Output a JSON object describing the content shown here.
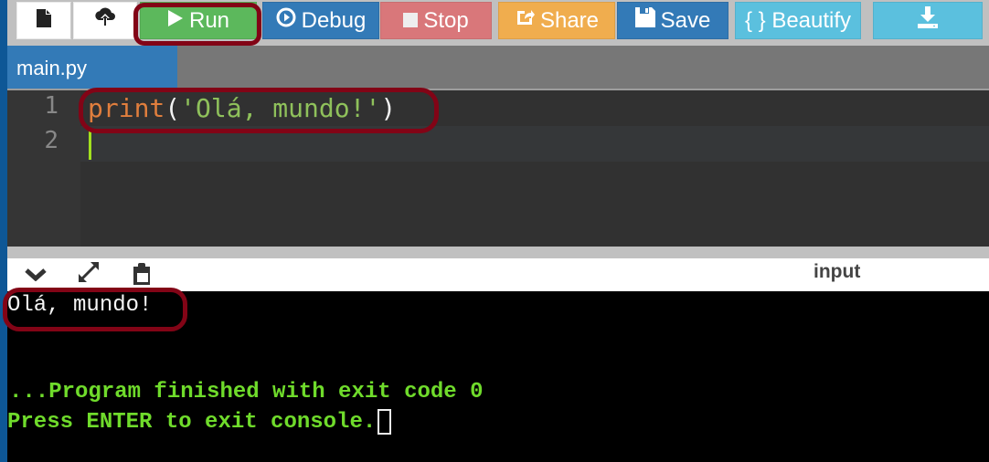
{
  "toolbar": {
    "new_file_icon": "file-icon",
    "upload_icon": "cloud-upload-icon",
    "run": {
      "label": "Run",
      "icon": "play-icon",
      "color": "#5cb85c"
    },
    "debug": {
      "label": "Debug",
      "icon": "circle-play-icon",
      "color": "#337ab7"
    },
    "stop": {
      "label": "Stop",
      "icon": "stop-square-icon",
      "color": "#d9777a"
    },
    "share": {
      "label": "Share",
      "icon": "share-icon",
      "color": "#f0ad4e"
    },
    "save": {
      "label": "Save",
      "icon": "floppy-disk-icon",
      "color": "#337ab7"
    },
    "beautify": {
      "label": "{ } Beautify",
      "color": "#5bc0de"
    },
    "download": {
      "icon": "download-icon",
      "color": "#5bc0de"
    }
  },
  "tabs": [
    {
      "label": "main.py",
      "active": true
    }
  ],
  "editor": {
    "line_numbers": [
      "1",
      "2"
    ],
    "lines": [
      {
        "fn": "print",
        "open": "(",
        "str": "'Olá, mundo!'",
        "close": ")"
      },
      {
        "text": ""
      }
    ]
  },
  "console_toolbar": {
    "icons": [
      "chevron-down-icon",
      "expand-icon",
      "clipboard-icon"
    ],
    "input_label": "input"
  },
  "console": {
    "output": "Olá, mundo!",
    "finished": "...Program finished with exit code 0",
    "press_enter": "Press ENTER to exit console."
  },
  "annotations": {
    "highlight_color": "#820416"
  }
}
